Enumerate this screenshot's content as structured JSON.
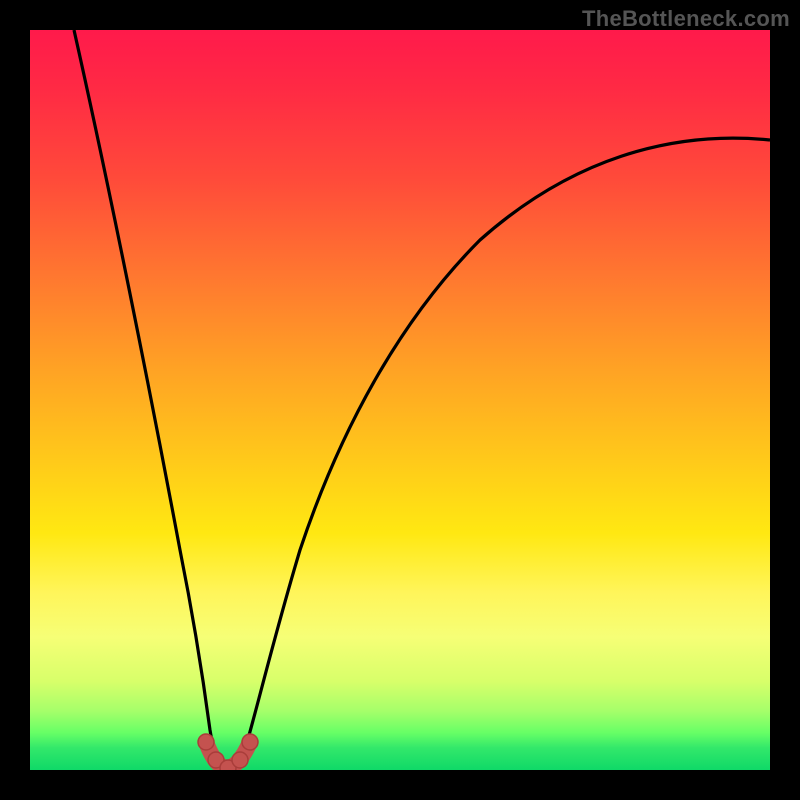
{
  "watermark": "TheBottleneck.com",
  "colors": {
    "curve": "#000000",
    "marker_fill": "#c4524f",
    "marker_stroke": "#a93d3a",
    "bottom_band": "#0fd968"
  },
  "chart_data": {
    "type": "line",
    "title": "",
    "xlabel": "",
    "ylabel": "",
    "xlim": [
      0,
      100
    ],
    "ylim": [
      0,
      100
    ],
    "grid": false,
    "legend": false,
    "notes": "Y read as bottleneck % (height from bottom). Minimum near x≈25.",
    "series": [
      {
        "name": "bottleneck-curve-left",
        "x": [
          6,
          10,
          15,
          20,
          23,
          25
        ],
        "y": [
          100,
          78,
          52,
          26,
          8,
          1
        ]
      },
      {
        "name": "bottleneck-curve-right",
        "x": [
          25,
          28,
          32,
          40,
          50,
          60,
          70,
          80,
          90,
          100
        ],
        "y": [
          1,
          8,
          22,
          46,
          62,
          72,
          78,
          82,
          84,
          85
        ]
      }
    ],
    "markers": {
      "name": "optimal-region-markers",
      "x": [
        23,
        24.2,
        25,
        25.8,
        27
      ],
      "y": [
        4,
        1.5,
        1,
        1.5,
        4
      ]
    }
  }
}
